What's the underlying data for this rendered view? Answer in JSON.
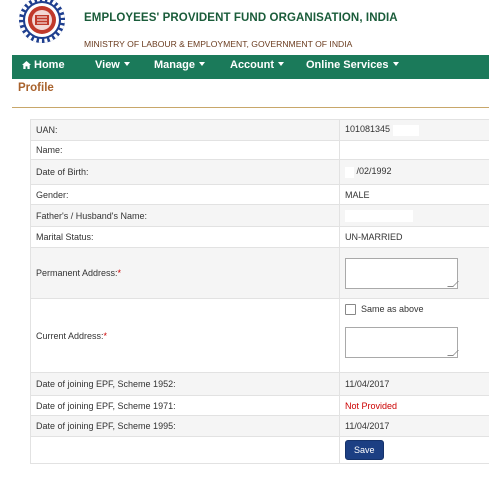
{
  "header": {
    "org_name": "EMPLOYEES' PROVIDENT FUND ORGANISATION, INDIA",
    "ministry": "MINISTRY OF LABOUR & EMPLOYMENT, GOVERNMENT OF INDIA"
  },
  "nav": {
    "items": [
      {
        "label": "Home",
        "icon": "home-icon"
      },
      {
        "label": "View",
        "icon": "caret-down-icon"
      },
      {
        "label": "Manage",
        "icon": "caret-down-icon"
      },
      {
        "label": "Account",
        "icon": "caret-down-icon"
      },
      {
        "label": "Online Services",
        "icon": "caret-down-icon"
      }
    ]
  },
  "page": {
    "title": "Profile"
  },
  "profile": {
    "uan": {
      "label": "UAN:",
      "value": "101081345"
    },
    "name": {
      "label": "Name:",
      "value": ""
    },
    "dob": {
      "label": "Date of Birth:",
      "value": "/02/1992"
    },
    "gender": {
      "label": "Gender:",
      "value": "MALE"
    },
    "father_husband": {
      "label": "Father's / Husband's Name:",
      "value": ""
    },
    "marital": {
      "label": "Marital Status:",
      "value": "UN-MARRIED"
    },
    "permanent_address": {
      "label": "Permanent Address:",
      "required_mark": "*",
      "value": ""
    },
    "current_address": {
      "label": "Current Address:",
      "required_mark": "*",
      "same_as_above_label": "Same as above",
      "same_as_above_checked": false,
      "value": ""
    },
    "doj_1952": {
      "label": "Date of joining EPF, Scheme 1952:",
      "value": "11/04/2017"
    },
    "doj_1971": {
      "label": "Date of joining EPF, Scheme 1971:",
      "value": "Not Provided"
    },
    "doj_1995": {
      "label": "Date of joining EPF, Scheme 1995:",
      "value": "11/04/2017"
    },
    "save_label": "Save"
  },
  "colors": {
    "nav_bg": "#1b7a5a",
    "title_green": "#1a5c3a",
    "profile_title": "#a8622c",
    "required_red": "#cc0000",
    "save_bg": "#1c3f83"
  }
}
